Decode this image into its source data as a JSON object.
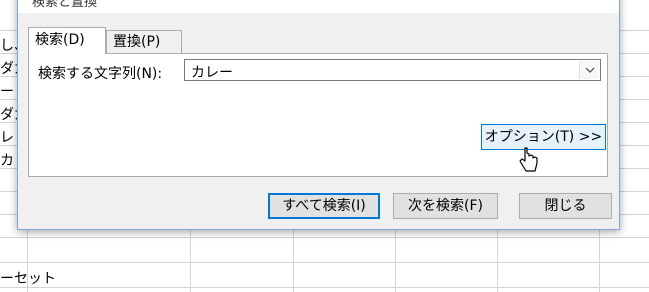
{
  "window": {
    "title": "検索と置換"
  },
  "tabs": [
    {
      "label": "検索(D)",
      "active": true
    },
    {
      "label": "置換(P)",
      "active": false
    }
  ],
  "find": {
    "label": "検索する文字列(N):",
    "value": "カレー"
  },
  "buttons": {
    "options": "オプション(T) >>",
    "find_all": "すべて検索(I)",
    "find_next": "次を検索(F)",
    "close": "閉じる"
  },
  "sheet": {
    "cells": [
      "し、こ",
      "ダガ",
      "ー",
      "ダガ",
      "レ",
      "カレ",
      "ーセット"
    ]
  },
  "colors": {
    "accent": "#0078d7",
    "dialog_bg": "#f0f0f0",
    "button_bg": "#e1e1e1",
    "grid": "#d4d4d4"
  },
  "icons": {
    "combo": "chevron-down-icon",
    "cursor": "mouse-pointer-icon"
  }
}
